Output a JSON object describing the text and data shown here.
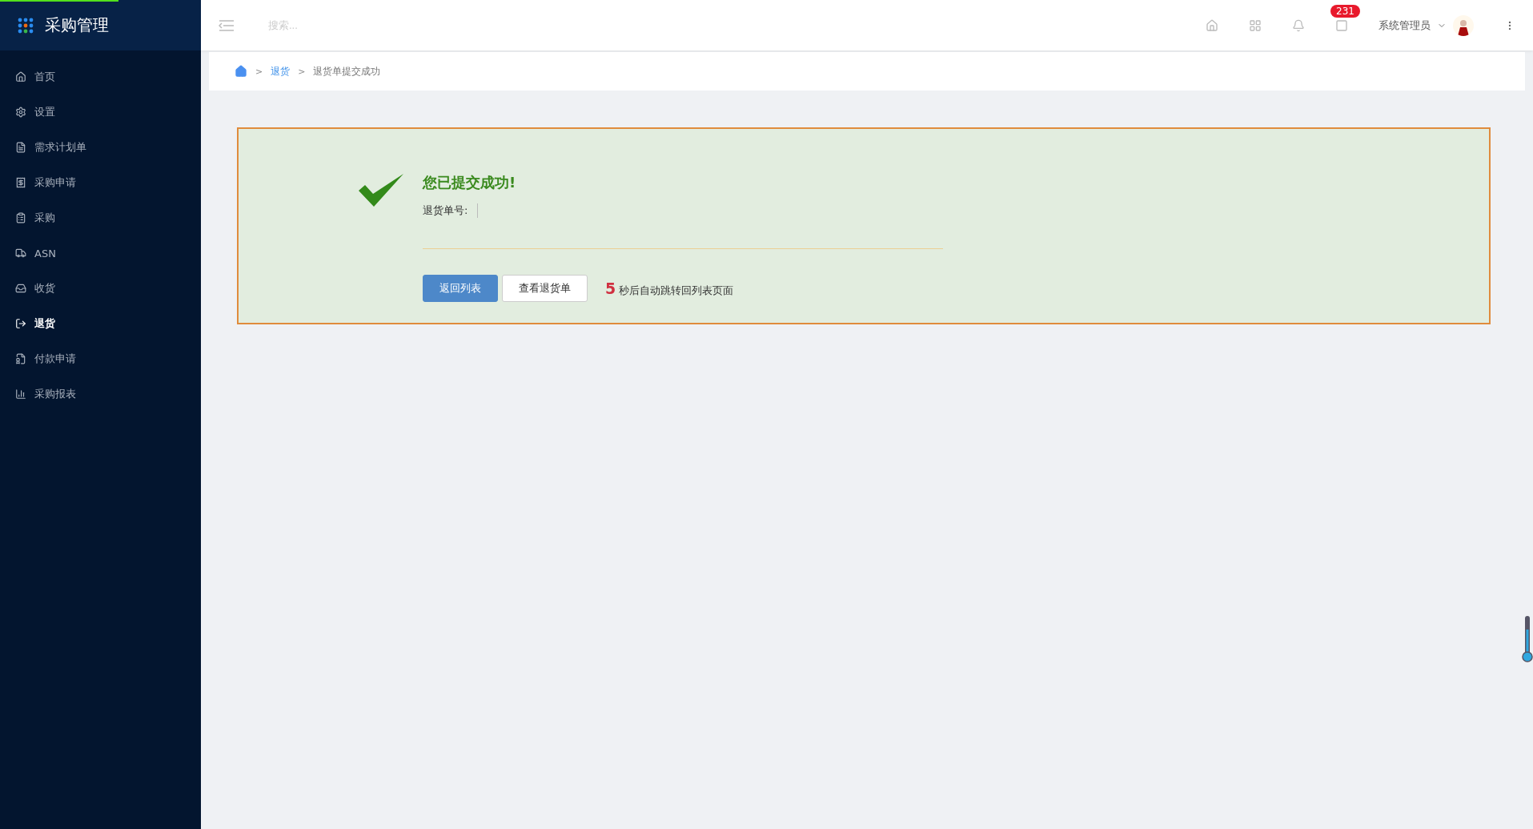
{
  "app": {
    "title": "采购管理"
  },
  "sidebar": {
    "items": [
      {
        "label": "首页",
        "selected": false
      },
      {
        "label": "设置",
        "selected": false
      },
      {
        "label": "需求计划单",
        "selected": false
      },
      {
        "label": "采购申请",
        "selected": false
      },
      {
        "label": "采购",
        "selected": false
      },
      {
        "label": "ASN",
        "selected": false
      },
      {
        "label": "收货",
        "selected": false
      },
      {
        "label": "退货",
        "selected": true
      },
      {
        "label": "付款申请",
        "selected": false
      },
      {
        "label": "采购报表",
        "selected": false
      }
    ]
  },
  "topbar": {
    "search": {
      "placeholder": "搜索..."
    },
    "message_count": "231",
    "user": "系统管理员"
  },
  "breadcrumb": [
    {
      "separator": ">",
      "label": "退货",
      "kind": "link"
    },
    {
      "separator": ">",
      "label": "退货单提交成功",
      "kind": "current"
    }
  ],
  "result": {
    "title": "您已提交成功!",
    "field_label": "退货单号:",
    "buttons": [
      {
        "label": "返回列表",
        "kind": "primary"
      },
      {
        "label": "查看退货单",
        "kind": "default"
      }
    ],
    "countdown": "5",
    "countdown_text": "秒后自动跳转回列表页面"
  }
}
